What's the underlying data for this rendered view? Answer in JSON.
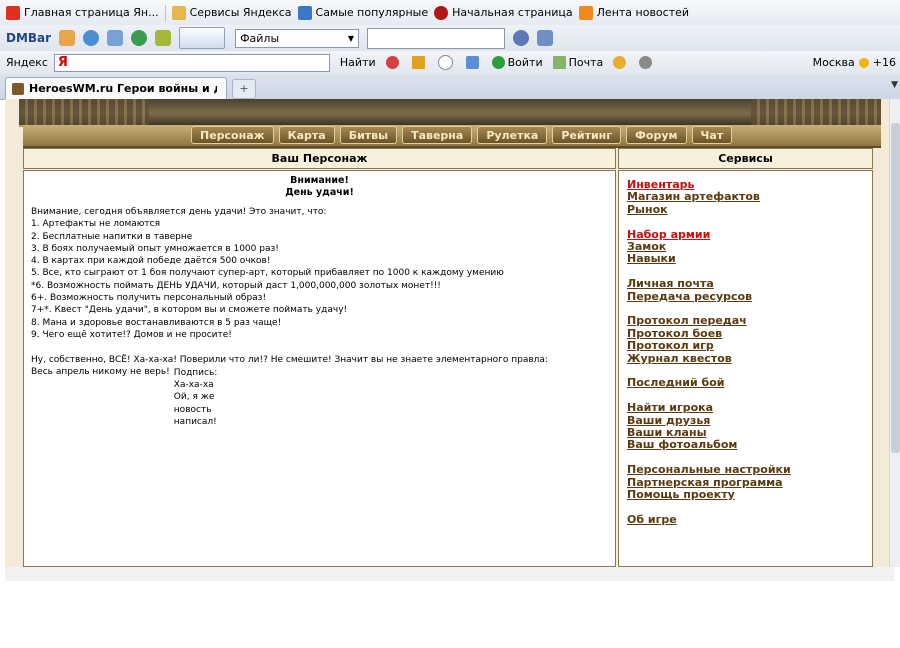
{
  "bookmarks": [
    {
      "label": "Главная страница Ян...",
      "color": "#e03020"
    },
    {
      "label": "Сервисы Яндекса",
      "color": "#e5b84a"
    },
    {
      "label": "Самые популярные",
      "color": "#3a78c8"
    },
    {
      "label": "Начальная страница",
      "color": "#b01818"
    },
    {
      "label": "Лента новостей",
      "color": "#f08a1e"
    }
  ],
  "toolbar": {
    "brand": "DMBar",
    "files_label": "Файлы"
  },
  "yandex_bar": {
    "label": "Яндекс",
    "search_value": "Я",
    "find_label": "Найти",
    "login_label": "Войти",
    "mail_label": "Почта",
    "city": "Москва",
    "temperature": "+16"
  },
  "browser_tab": {
    "title": "HeroesWM.ru Герои войны и денег..."
  },
  "site_menu": [
    "Персонаж",
    "Карта",
    "Битвы",
    "Таверна",
    "Рулетка",
    "Рейтинг",
    "Форум",
    "Чат"
  ],
  "left_panel": {
    "title": "Ваш Персонаж",
    "notice_title_1": "Внимание!",
    "notice_title_2": "День удачи!",
    "lines": [
      "Внимание, сегодня объявляется день удачи! Это значит, что:",
      "1. Артефакты не ломаются",
      "2. Бесплатные напитки в таверне",
      "3. В боях получаемый опыт умножается в 1000 раз!",
      "4. В картах при каждой победе даётся 500 очков!",
      "5. Все, кто сыграют от 1 боя получают супер-арт, который прибавляет по 1000 к каждому умению",
      "*6. Возможность поймать ДЕНЬ УДАЧИ, который даст 1,000,000,000 золотых монет!!!",
      "6+. Возможность получить персональный образ!",
      "7+*. Квест \"День удачи\", в котором вы и сможете поймать удачу!",
      "8. Мана и здоровье востанавливаются в 5 раз чаще!",
      "9. Чего ещё хотите!? Домов и не просите!"
    ],
    "closing_1": "Ну, собственно, ВСЁ! Ха-ха-ха! Поверили что ли!? Не смешите! Значит вы не знаете элементарного правла:",
    "closing_2": "Весь апрель никому не верь!",
    "signature": [
      "Подпись:",
      "Ха-ха-ха",
      "Ой, я же",
      "новость",
      "написал!"
    ]
  },
  "right_panel": {
    "title": "Сервисы",
    "groups": [
      [
        {
          "label": "Инвентарь",
          "highlight": true
        },
        {
          "label": "Магазин артефактов"
        },
        {
          "label": "Рынок"
        }
      ],
      [
        {
          "label": "Набор армии",
          "highlight": true
        },
        {
          "label": "Замок"
        },
        {
          "label": "Навыки"
        }
      ],
      [
        {
          "label": "Личная почта"
        },
        {
          "label": "Передача ресурсов"
        }
      ],
      [
        {
          "label": "Протокол передач"
        },
        {
          "label": "Протокол боев"
        },
        {
          "label": "Протокол игр"
        },
        {
          "label": "Журнал квестов"
        }
      ],
      [
        {
          "label": "Последний бой"
        }
      ],
      [
        {
          "label": "Найти игрока"
        },
        {
          "label": "Ваши друзья"
        },
        {
          "label": "Ваши кланы"
        },
        {
          "label": "Ваш фотоальбом"
        }
      ],
      [
        {
          "label": "Персональные настройки"
        },
        {
          "label": "Партнерская программа"
        },
        {
          "label": "Помощь проекту"
        }
      ],
      [
        {
          "label": "Об игре"
        }
      ]
    ]
  }
}
